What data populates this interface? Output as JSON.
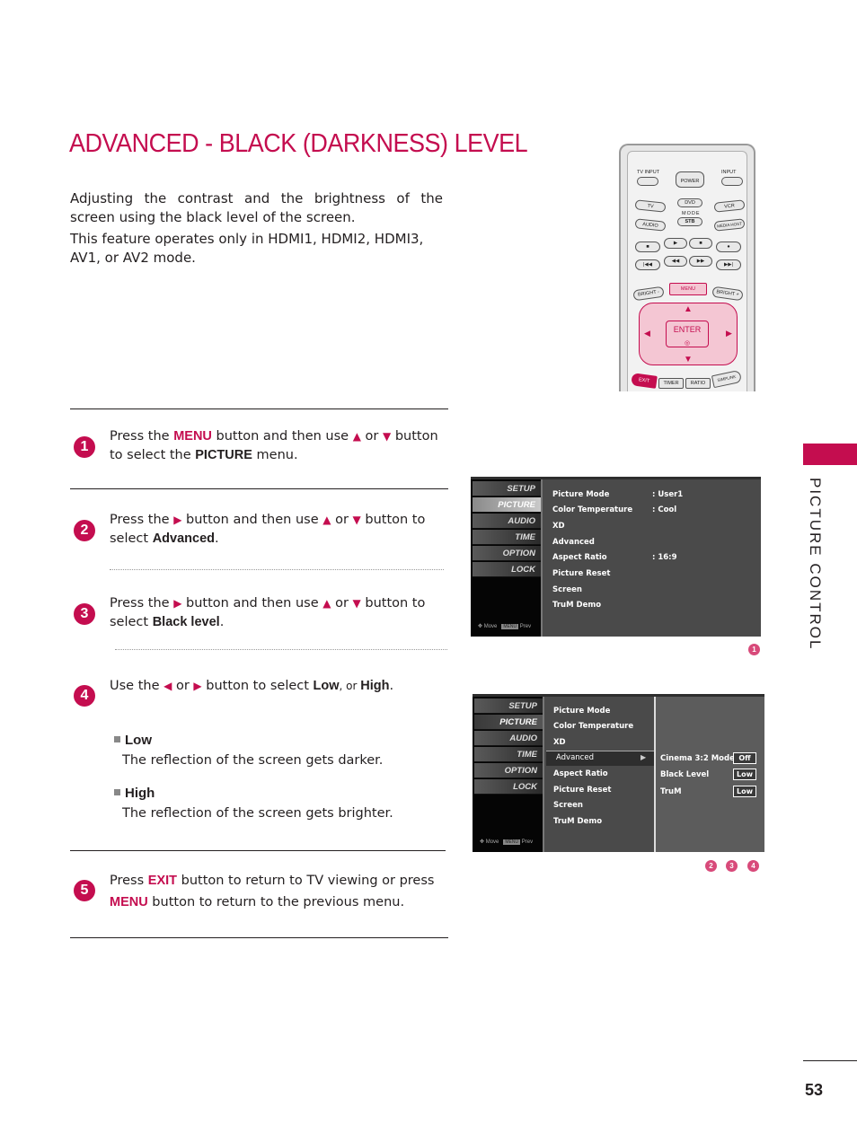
{
  "title": "ADVANCED - BLACK (DARKNESS) LEVEL",
  "intro": [
    "Adjusting the contrast and the brightness of the screen using the black level of the screen.",
    "This feature operates only in HDMI1, HDMI2, HDMI3, AV1, or AV2 mode."
  ],
  "side_tab": "PICTURE CONTROL",
  "page_number": "53",
  "accent_color": "#c40d4f",
  "steps": [
    {
      "num": "1",
      "p1": "Press the ",
      "k1": "MENU",
      "p2": " button and then use ",
      "up": "▲",
      "or": " or ",
      "down": "▼",
      "p3": " button to select the ",
      "k2": "PICTURE",
      "p4": " menu."
    },
    {
      "num": "2",
      "p1": "Press the ",
      "right": "▶",
      "p2": " button and then use ",
      "up": "▲",
      "or": " or ",
      "down": "▼",
      "p3": " button to select ",
      "k2": "Advanced",
      "p4": "."
    },
    {
      "num": "3",
      "p1": "Press the ",
      "right": "▶",
      "p2": " button and then use ",
      "up": "▲",
      "or": " or ",
      "down": "▼",
      "p3": " button to select ",
      "k2": "Black level",
      "p4": "."
    },
    {
      "num": "4",
      "p1": "Use the ",
      "left": "◀",
      "or": " or ",
      "right": "▶",
      "p2": " button to select  ",
      "k1": "Low",
      "p3": ", or ",
      "k2": "High",
      "p4": "."
    },
    {
      "num": "5",
      "p1": "Press ",
      "k1": "EXIT",
      "p2": " button to return to TV viewing or press ",
      "k2": "MENU",
      "p3": " button to return to the previous menu."
    }
  ],
  "options": [
    {
      "name": "Low",
      "desc": "The reflection of the screen gets darker."
    },
    {
      "name": "High",
      "desc": "The reflection of the screen gets brighter."
    }
  ],
  "remote": {
    "tv_input": "TV INPUT",
    "power": "POWER",
    "input": "INPUT",
    "tv": "TV",
    "dvd": "DVD",
    "vcr": "VCR",
    "mode": "MODE",
    "audio": "AUDIO",
    "stb": "STB",
    "media_host": "MEDIA HOST",
    "stop": "■",
    "play": "▶",
    "pause": "■",
    "rec": "●",
    "prev": "|◀◀",
    "rew": "◀◀",
    "ff": "▶▶",
    "next": "▶▶|",
    "bright_minus": "BRIGHT -",
    "menu": "MENU",
    "bright_plus": "BRIGHT +",
    "enter": "ENTER",
    "up": "▲",
    "down": "▼",
    "left": "◀",
    "right": "▶",
    "exit": "EXIT",
    "timer": "TIMER",
    "ratio": "RATIO",
    "simplink": "SIMPLINK"
  },
  "osd1": {
    "tabs": [
      "SETUP",
      "PICTURE",
      "AUDIO",
      "TIME",
      "OPTION",
      "LOCK"
    ],
    "active_tab": "PICTURE",
    "footer_move": "Move",
    "footer_key": "MENU",
    "footer_prev": "Prev",
    "items": [
      {
        "label": "Picture Mode",
        "value": ": User1"
      },
      {
        "label": "Color Temperature",
        "value": ": Cool"
      },
      {
        "label": "XD",
        "value": ""
      },
      {
        "label": "Advanced",
        "value": ""
      },
      {
        "label": "Aspect Ratio",
        "value": ": 16:9"
      },
      {
        "label": "Picture Reset",
        "value": ""
      },
      {
        "label": "Screen",
        "value": ""
      },
      {
        "label": "TruM Demo",
        "value": ""
      }
    ],
    "badge": "1"
  },
  "osd2": {
    "tabs": [
      "SETUP",
      "PICTURE",
      "AUDIO",
      "TIME",
      "OPTION",
      "LOCK"
    ],
    "active_tab": "PICTURE",
    "footer_move": "Move",
    "footer_key": "MENU",
    "footer_prev": "Prev",
    "items": [
      "Picture Mode",
      "Color Temperature",
      "XD",
      "Advanced",
      "Aspect Ratio",
      "Picture Reset",
      "Screen",
      "TruM Demo"
    ],
    "selected": "Advanced",
    "selected_arrow": "▶",
    "sub_items": [
      {
        "label": "Cinema 3:2 Mode",
        "value": "Off"
      },
      {
        "label": "Black Level",
        "value": "Low"
      },
      {
        "label": "TruM",
        "value": "Low"
      }
    ],
    "badges": [
      "2",
      "3",
      "4"
    ]
  }
}
